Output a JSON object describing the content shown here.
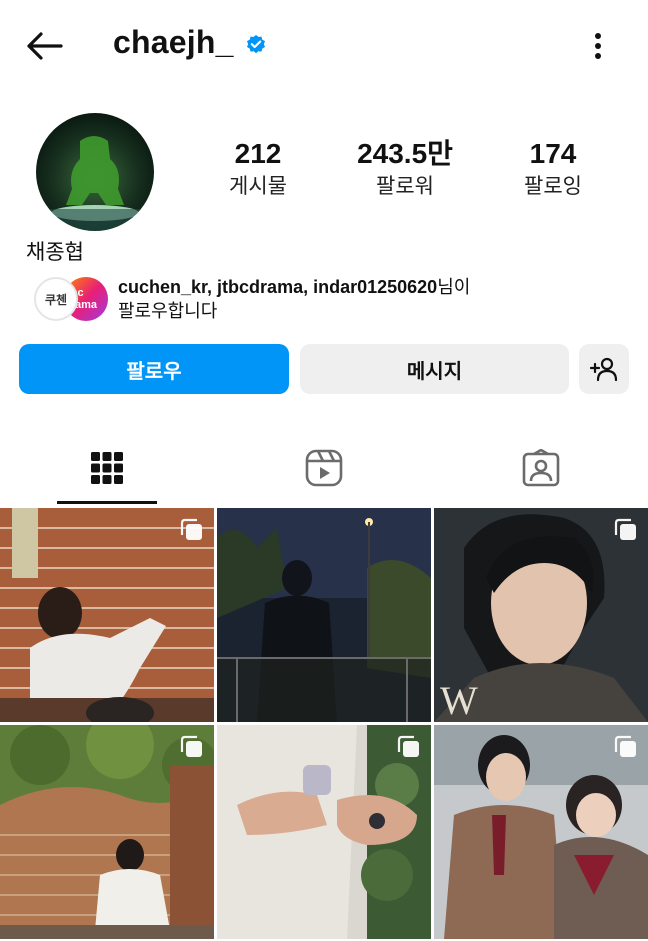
{
  "header": {
    "username": "chaejh_",
    "icons": {
      "back": "arrow-left-icon",
      "verified": "verified-badge-icon",
      "more": "more-vertical-icon"
    }
  },
  "profile": {
    "stats": [
      {
        "value": "212",
        "label": "게시물"
      },
      {
        "value": "243.5만",
        "label": "팔로워"
      },
      {
        "value": "174",
        "label": "팔로잉"
      }
    ],
    "full_name": "채종협",
    "followed_by": {
      "avatars": [
        "쿠첸",
        "jtbc drama"
      ],
      "accounts": "cuchen_kr, jtbcdrama, indar01250620",
      "suffix_line1": "님이",
      "line2": "팔로우합니다"
    }
  },
  "actions": {
    "follow_label": "팔로우",
    "message_label": "메시지",
    "add_user_icon": "add-user-icon"
  },
  "tabs": [
    {
      "name": "posts",
      "icon": "grid-icon",
      "active": true
    },
    {
      "name": "reels",
      "icon": "reels-icon",
      "active": false
    },
    {
      "name": "tagged",
      "icon": "tagged-user-icon",
      "active": false
    }
  ],
  "posts": [
    {
      "kind": "photo",
      "multi": true,
      "desc": "brick wall"
    },
    {
      "kind": "photo",
      "multi": false,
      "desc": "night street"
    },
    {
      "kind": "photo",
      "multi": true,
      "desc": "portrait"
    },
    {
      "kind": "photo",
      "multi": true,
      "desc": "garden wall"
    },
    {
      "kind": "photo",
      "multi": true,
      "desc": "hands"
    },
    {
      "kind": "photo",
      "multi": true,
      "desc": "school uniform"
    }
  ],
  "colors": {
    "accent": "#0095f6",
    "secondary_button": "#efefef",
    "verified": "#0095f6"
  }
}
